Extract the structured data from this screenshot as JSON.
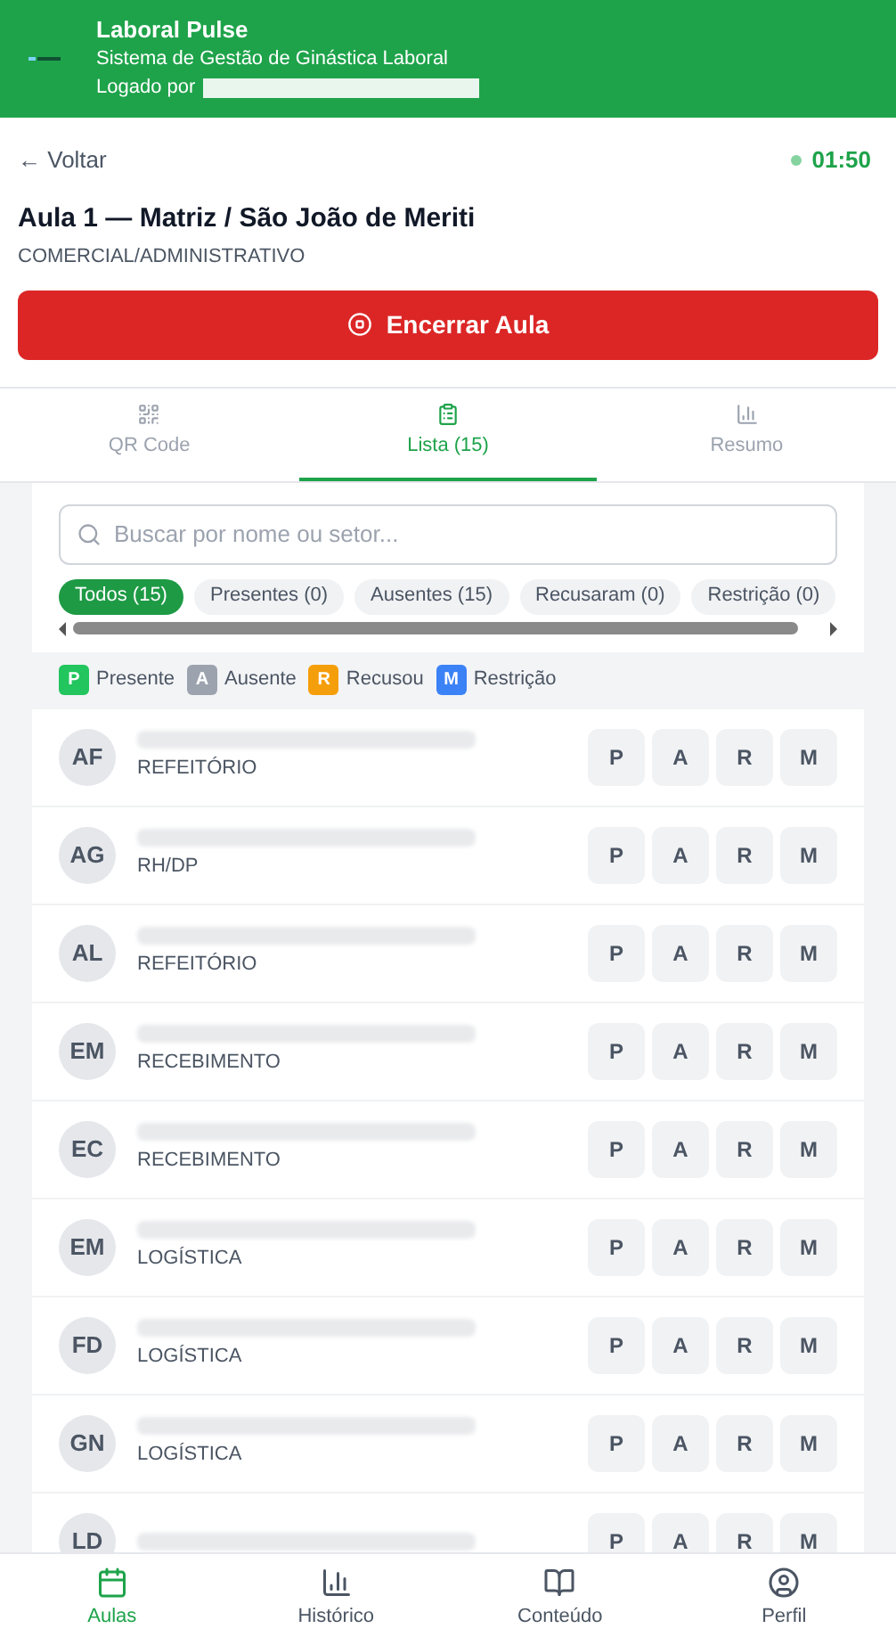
{
  "header": {
    "title": "Laboral Pulse",
    "subtitle": "Sistema de Gestão de Ginástica Laboral",
    "login_label": "Logado por"
  },
  "back": "← Voltar",
  "timer": "01:50",
  "class": {
    "title": "Aula 1 — Matriz / São João de Meriti",
    "sector": "COMERCIAL/ADMINISTRATIVO"
  },
  "end_button": "Encerrar Aula",
  "tabs": [
    {
      "label": "QR Code",
      "selected": false
    },
    {
      "label": "Lista (15)",
      "selected": true
    },
    {
      "label": "Resumo",
      "selected": false
    }
  ],
  "search": {
    "placeholder": "Buscar por nome ou setor..."
  },
  "filters": [
    {
      "label": "Todos (15)",
      "selected": true
    },
    {
      "label": "Presentes (0)",
      "selected": false
    },
    {
      "label": "Ausentes (15)",
      "selected": false
    },
    {
      "label": "Recusaram (0)",
      "selected": false
    },
    {
      "label": "Restrição (0)",
      "selected": false
    }
  ],
  "legend": [
    {
      "key": "P",
      "label": "Presente",
      "color": "#22c55e"
    },
    {
      "key": "A",
      "label": "Ausente",
      "color": "#9ca3af"
    },
    {
      "key": "R",
      "label": "Recusou",
      "color": "#f59e0b"
    },
    {
      "key": "M",
      "label": "Restrição",
      "color": "#3b82f6"
    }
  ],
  "people": [
    {
      "initials": "AF",
      "sector": "REFEITÓRIO",
      "actions": [
        "P",
        "A",
        "R",
        "M"
      ]
    },
    {
      "initials": "AG",
      "sector": "RH/DP",
      "actions": [
        "P",
        "A",
        "R",
        "M"
      ]
    },
    {
      "initials": "AL",
      "sector": "REFEITÓRIO",
      "actions": [
        "P",
        "A",
        "R",
        "M"
      ]
    },
    {
      "initials": "EM",
      "sector": "RECEBIMENTO",
      "actions": [
        "P",
        "A",
        "R",
        "M"
      ]
    },
    {
      "initials": "EC",
      "sector": "RECEBIMENTO",
      "actions": [
        "P",
        "A",
        "R",
        "M"
      ]
    },
    {
      "initials": "EM",
      "sector": "LOGÍSTICA",
      "actions": [
        "P",
        "A",
        "R",
        "M"
      ]
    },
    {
      "initials": "FD",
      "sector": "LOGÍSTICA",
      "actions": [
        "P",
        "A",
        "R",
        "M"
      ]
    },
    {
      "initials": "GN",
      "sector": "LOGÍSTICA",
      "actions": [
        "P",
        "A",
        "R",
        "M"
      ]
    },
    {
      "initials": "LD",
      "actions": [
        "P",
        "A",
        "R",
        "M"
      ]
    }
  ],
  "nav": [
    {
      "label": "Aulas",
      "selected": true
    },
    {
      "label": "Histórico",
      "selected": false
    },
    {
      "label": "Conteúdo",
      "selected": false
    },
    {
      "label": "Perfil",
      "selected": false
    }
  ]
}
